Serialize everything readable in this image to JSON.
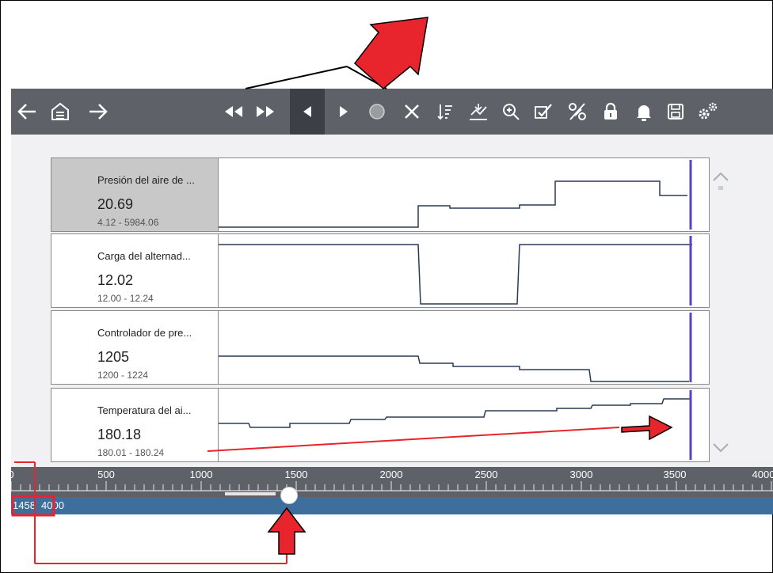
{
  "toolbar": {
    "icons": [
      "back-arrow-icon",
      "home-icon",
      "forward-arrow-icon",
      "rewind-icon",
      "fast-forward-icon",
      "step-back-icon",
      "step-forward-icon",
      "record-icon",
      "clear-icon",
      "sort-icon",
      "graph-settings-icon",
      "zoom-icon",
      "select-icon",
      "percent-icon",
      "lock-icon",
      "bell-icon",
      "save-icon",
      "settings-icon"
    ]
  },
  "rows": [
    {
      "name": "Presión del aire de ...",
      "value": "20.69",
      "range": "4.12 - 5984.06",
      "selected": true
    },
    {
      "name": "Carga del alternad...",
      "value": "12.02",
      "range": "12.00 - 12.24",
      "selected": false
    },
    {
      "name": "Controlador de pre...",
      "value": "1205",
      "range": "1200 - 1224",
      "selected": false
    },
    {
      "name": "Temperatura del ai...",
      "value": "180.18",
      "range": "180.01 - 180.24",
      "selected": false
    }
  ],
  "ruler": {
    "labels": [
      "0",
      "500",
      "1000",
      "1500",
      "2000",
      "2500",
      "3000",
      "3500",
      "4000"
    ]
  },
  "frame_bar": {
    "current": "1458",
    "total": "4000"
  },
  "slider": {
    "value": 1458,
    "max": 4000
  },
  "colors": {
    "toolbar": "#5e6168",
    "cursor": "#5b3fd1",
    "trace": "#2a3a55",
    "bar": "#3d6e9c",
    "callout": "#e8242c"
  }
}
